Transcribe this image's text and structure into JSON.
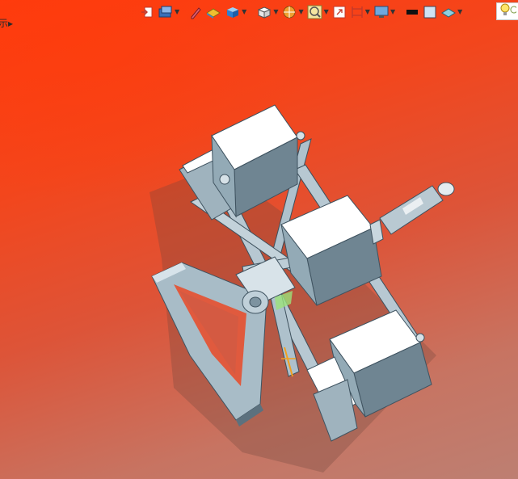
{
  "viewport": {
    "left_clipped_text": "示▸",
    "background_colors": [
      "#ff3a0e",
      "#dd5438",
      "#bd7f72"
    ]
  },
  "toolbar": {
    "items": [
      {
        "icon": "view-orientation-icon"
      },
      {
        "icon": "display-style-icon",
        "dropdown": true
      },
      {
        "icon": "sketch-pencil-icon"
      },
      {
        "icon": "section-view-icon"
      },
      {
        "icon": "shaded-cube-icon",
        "dropdown": true
      },
      {
        "icon": "view-cube-icon",
        "dropdown": true
      },
      {
        "icon": "render-sphere-icon",
        "dropdown": true
      },
      {
        "icon": "zoom-search-icon",
        "dropdown": true
      },
      {
        "icon": "zoom-fit-icon"
      },
      {
        "icon": "dimension-icon",
        "dropdown": true
      },
      {
        "icon": "monitor-settings-icon",
        "dropdown": true
      },
      {
        "icon": "edge-color-black-icon"
      },
      {
        "icon": "face-color-icon"
      },
      {
        "icon": "appearance-icon",
        "dropdown": true
      },
      {
        "icon": "lightbulb-icon"
      }
    ]
  },
  "colors": {
    "part_light": "#c9d7df",
    "part_mid": "#93aab6",
    "part_dark": "#5f7582",
    "box_top": "#ffffff",
    "box_side": "#6f8592",
    "shadow": "rgba(95,65,60,0.45)"
  }
}
